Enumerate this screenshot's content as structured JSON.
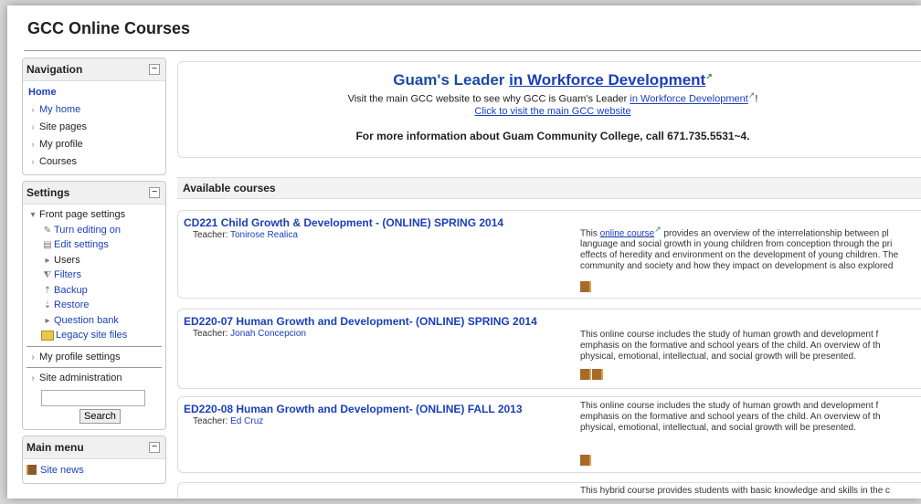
{
  "site": {
    "title": "GCC Online Courses"
  },
  "navigation": {
    "title": "Navigation",
    "home": "Home",
    "items": [
      "My home",
      "Site pages",
      "My profile",
      "Courses"
    ]
  },
  "settings": {
    "title": "Settings",
    "front_page": "Front page settings",
    "items": [
      {
        "label": "Turn editing on",
        "icon": "pencil-icon"
      },
      {
        "label": "Edit settings",
        "icon": "settings-icon"
      },
      {
        "label": "Users",
        "icon": "triangle-icon"
      },
      {
        "label": "Filters",
        "icon": "filter-icon"
      },
      {
        "label": "Backup",
        "icon": "backup-icon"
      },
      {
        "label": "Restore",
        "icon": "restore-icon"
      },
      {
        "label": "Question bank",
        "icon": "triangle-icon"
      },
      {
        "label": "Legacy site files",
        "icon": "folder-icon"
      }
    ],
    "my_profile": "My profile settings",
    "site_admin": "Site administration",
    "search_button": "Search"
  },
  "main_menu": {
    "title": "Main menu",
    "site_news": "Site news"
  },
  "banner": {
    "title_text": "Guam's Leader ",
    "title_link": "in Workforce Development",
    "line1_text": "Visit the main GCC website to see why GCC is Guam's Leader ",
    "line1_link": "in Workforce Development",
    "line1_end": "!",
    "line2_link": "Click to visit the main GCC website",
    "info": "For more information about Guam Community College, call 671.735.5531~4."
  },
  "available_courses": {
    "heading": "Available courses",
    "courses": [
      {
        "title": "CD221 Child Growth & Development - (ONLINE) SPRING 2014",
        "teacher_label": "Teacher: ",
        "teacher": "Tonirose Realica",
        "desc_lines": [
          "This online course provides an overview of the interrelationship between pl",
          "language and social growth in young children from conception through the pri",
          "effects of heredity and environment on the development of young children. The",
          "community and society and how they impact on development is also explored"
        ]
      },
      {
        "title": "ED220-07 Human Growth and Development- (ONLINE) SPRING 2014",
        "teacher_label": "Teacher: ",
        "teacher": "Jonah Concepcion",
        "desc_lines": [
          "This online course includes the study of human growth and development f",
          "emphasis on the formative and school years of the child. An overview of th",
          "physical, emotional, intellectual, and social growth will be presented."
        ]
      },
      {
        "title": "ED220-08 Human Growth and Development- (ONLINE) FALL 2013",
        "teacher_label": "Teacher: ",
        "teacher": "Ed Cruz",
        "desc_lines": [
          "This online course includes the study of human growth and development f",
          "emphasis on the formative and school years of the child. An overview of th",
          "physical, emotional, intellectual, and social growth will be presented."
        ]
      },
      {
        "title": "",
        "desc_lines": [
          "This hybrid course provides students with basic knowledge and skills in the c"
        ]
      }
    ]
  }
}
